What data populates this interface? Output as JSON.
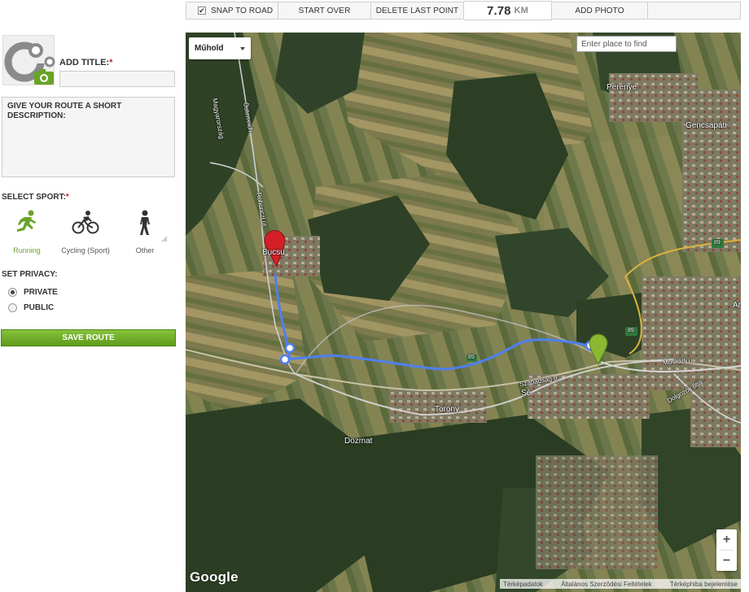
{
  "toolbar": {
    "snap_to_road": "SNAP TO ROAD",
    "snap_checked": true,
    "start_over": "START OVER",
    "delete_last_point": "DELETE LAST POINT",
    "distance_value": "7.78",
    "distance_unit": "KM",
    "add_photo": "ADD PHOTO"
  },
  "form": {
    "title_label": "ADD TITLE:",
    "required_mark": "*",
    "title_value": "",
    "description_label": "GIVE YOUR ROUTE A SHORT DESCRIPTION:",
    "description_value": "",
    "sport_label": "SELECT SPORT:",
    "sports": [
      {
        "label": "Running",
        "icon": "running-icon",
        "selected": true
      },
      {
        "label": "Cycling (Sport)",
        "icon": "cycling-icon",
        "selected": false
      },
      {
        "label": "Other",
        "icon": "walking-icon",
        "selected": false
      }
    ],
    "privacy_label": "SET PRIVACY:",
    "privacy_options": [
      {
        "label": "PRIVATE",
        "selected": true
      },
      {
        "label": "PUBLIC",
        "selected": false
      }
    ],
    "save_button": "SAVE ROUTE"
  },
  "map": {
    "map_type": "Műhold",
    "search_placeholder": "Enter place to find",
    "zoom_in": "+",
    "zoom_out": "−",
    "logo": "Google",
    "attribution": [
      "Térképadatok",
      "Általános Szerződési Feltételek",
      "Térképhiba bejelentése"
    ],
    "towns": {
      "perenye": "Perenye",
      "gencsapati": "Gencsapáti",
      "torony": "Torony",
      "se": "Sé",
      "dozmat": "Dozmat",
      "bucsu": "Bucsu",
      "ar": "Ar"
    },
    "roads": {
      "magyarorszag": "Magyarország",
      "osterreich": "Österreich",
      "rohonczi": "Rohonczi út",
      "szabadsag": "Szabadság u.",
      "muskatli": "Muskátli u.",
      "dolgozok": "Dolgozók útja",
      "r89a": "89",
      "r89b": "89",
      "r89c": "89"
    },
    "colors": {
      "route": "#4f7ff0",
      "start_marker": "#d32027",
      "end_marker": "#8ab833",
      "waypoint": "#4f7ff0"
    }
  }
}
